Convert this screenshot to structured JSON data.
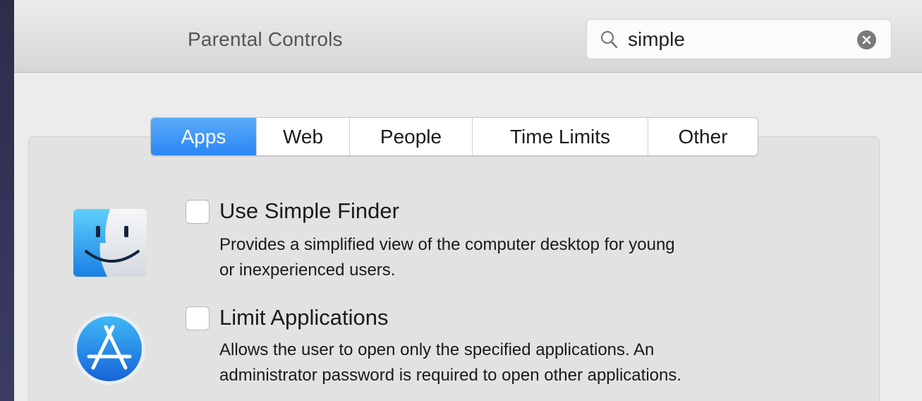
{
  "window": {
    "title": "Parental Controls"
  },
  "search": {
    "value": "simple",
    "placeholder": ""
  },
  "tabs": [
    {
      "label": "Apps",
      "active": true
    },
    {
      "label": "Web",
      "active": false
    },
    {
      "label": "People",
      "active": false
    },
    {
      "label": "Time Limits",
      "active": false
    },
    {
      "label": "Other",
      "active": false
    }
  ],
  "options": [
    {
      "label": "Use Simple Finder",
      "checked": false,
      "icon": "finder-icon",
      "description_lines": [
        "Provides a simplified view of the computer desktop for young",
        "or inexperienced users."
      ]
    },
    {
      "label": "Limit Applications",
      "checked": false,
      "icon": "app-store-icon",
      "description_lines": [
        "Allows the user to open only the specified applications. An",
        "administrator password is required to open other applications."
      ]
    }
  ],
  "colors": {
    "accent": "#2b87f5",
    "window_bg": "#ececec",
    "desktop_bg": "#2c2d49"
  }
}
